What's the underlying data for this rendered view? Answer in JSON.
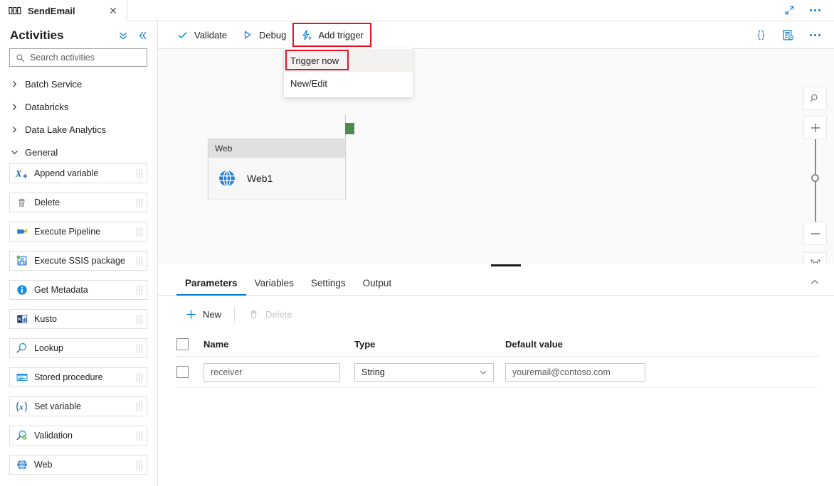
{
  "window": {
    "tab": {
      "title": "SendEmail",
      "icon": "pipeline-icon",
      "close_icon": "close-icon"
    },
    "actions": {
      "expand_icon": "expand-diagonal-icon",
      "more_icon": "more-ellipsis-icon"
    }
  },
  "sidebar": {
    "title": "Activities",
    "collapse_all_icon": "double-chevron-down-icon",
    "collapse_panel_icon": "double-chevron-left-icon",
    "search": {
      "placeholder": "Search activities",
      "value": "",
      "icon": "search-icon"
    },
    "groups": [
      {
        "label": "Batch Service",
        "expanded": false
      },
      {
        "label": "Databricks",
        "expanded": false
      },
      {
        "label": "Data Lake Analytics",
        "expanded": false
      },
      {
        "label": "General",
        "expanded": true
      }
    ],
    "activities": [
      {
        "label": "Append variable",
        "icon": "append-variable-icon"
      },
      {
        "label": "Delete",
        "icon": "trash-icon"
      },
      {
        "label": "Execute Pipeline",
        "icon": "execute-pipeline-icon"
      },
      {
        "label": "Execute SSIS package",
        "icon": "ssis-package-icon"
      },
      {
        "label": "Get Metadata",
        "icon": "info-icon"
      },
      {
        "label": "Kusto",
        "icon": "kusto-icon"
      },
      {
        "label": "Lookup",
        "icon": "magnifier-icon"
      },
      {
        "label": "Stored procedure",
        "icon": "stored-procedure-icon"
      },
      {
        "label": "Set variable",
        "icon": "set-variable-icon"
      },
      {
        "label": "Validation",
        "icon": "validation-icon"
      },
      {
        "label": "Web",
        "icon": "globe-icon"
      }
    ]
  },
  "toolbar": {
    "validate": {
      "label": "Validate",
      "icon": "checkmark-icon"
    },
    "debug": {
      "label": "Debug",
      "icon": "play-triangle-icon"
    },
    "add_trigger": {
      "label": "Add trigger",
      "icon": "lightning-bolt-plus-icon",
      "highlighted": true
    },
    "right": {
      "code": {
        "icon": "code-braces-icon",
        "label": "{ }"
      },
      "properties": {
        "icon": "properties-gear-icon"
      },
      "more": {
        "icon": "more-ellipsis-icon"
      }
    }
  },
  "trigger_menu": {
    "open": true,
    "items": [
      {
        "label": "Trigger now",
        "hovered": true,
        "annotated": true
      },
      {
        "label": "New/Edit",
        "hovered": false,
        "annotated": false
      }
    ]
  },
  "canvas": {
    "node": {
      "type_label": "Web",
      "name": "Web1",
      "icon": "globe-icon",
      "output_connector": "success-connector"
    },
    "zoom_controls": {
      "search_icon": "zoom-search-icon",
      "plus_icon": "zoom-in-icon",
      "minus_icon": "zoom-out-icon",
      "fit_icon": "fit-to-screen-icon"
    }
  },
  "bottom_panel": {
    "tabs": [
      {
        "label": "Parameters",
        "active": true
      },
      {
        "label": "Variables",
        "active": false
      },
      {
        "label": "Settings",
        "active": false
      },
      {
        "label": "Output",
        "active": false
      }
    ],
    "collapse_icon": "chevron-up-icon",
    "commands": [
      {
        "label": "New",
        "icon": "plus-icon",
        "disabled": false
      },
      {
        "label": "Delete",
        "icon": "trash-icon",
        "disabled": true
      }
    ],
    "table": {
      "headers": [
        "Name",
        "Type",
        "Default value"
      ],
      "rows": [
        {
          "checked": false,
          "name": "receiver",
          "type": "String",
          "default_value": "youremail@contoso.com"
        }
      ]
    }
  },
  "colors": {
    "accent": "#0078d4",
    "annotation": "#e81123",
    "success_connector": "#4d8b4c",
    "canvas_bg": "#fafafa"
  }
}
